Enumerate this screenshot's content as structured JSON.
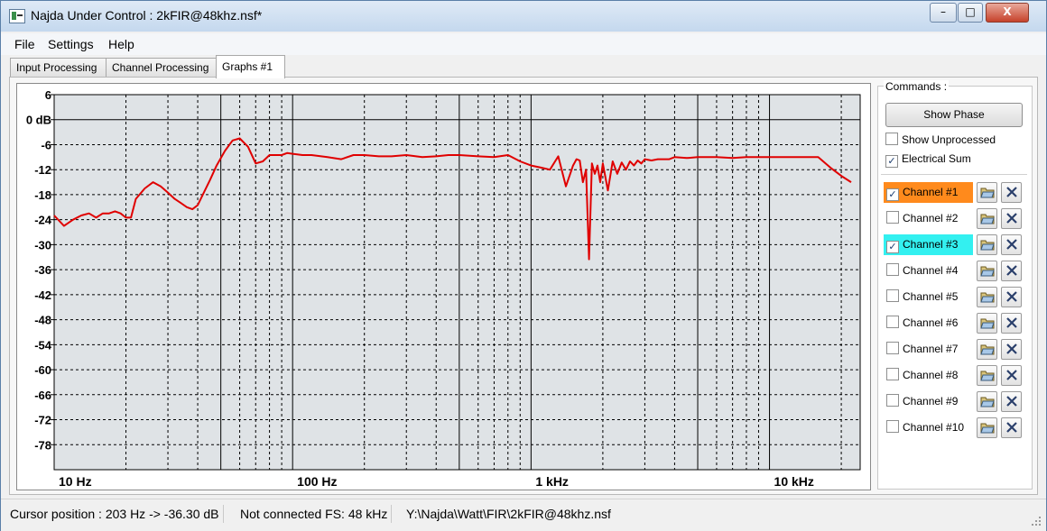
{
  "window": {
    "title": "Najda Under Control : 2kFIR@48khz.nsf*",
    "controls": [
      "–",
      "□",
      "X"
    ]
  },
  "menu": [
    {
      "label": "File"
    },
    {
      "label": "Settings"
    },
    {
      "label": "Help"
    }
  ],
  "tabs": [
    {
      "label": "Input Processing"
    },
    {
      "label": "Channel Processing"
    },
    {
      "label": "Graphs #1",
      "active": true
    }
  ],
  "graph": {
    "y_labels": [
      "6",
      "0 dB",
      "-6",
      "-12",
      "-18",
      "-24",
      "-30",
      "-36",
      "-42",
      "-48",
      "-54",
      "-60",
      "-66",
      "-72",
      "-78"
    ],
    "x_labels": [
      "10 Hz",
      "100 Hz",
      "1 kHz",
      "10 kHz"
    ],
    "curve_color": "#e00000",
    "background": "#dfe3e6"
  },
  "chart_data": {
    "type": "line",
    "x_scale": "log",
    "xlim": [
      10,
      24000
    ],
    "ylim": [
      -84,
      6
    ],
    "y_ticks": [
      6,
      0,
      -6,
      -12,
      -18,
      -24,
      -30,
      -36,
      -42,
      -48,
      -54,
      -60,
      -66,
      -72,
      -78
    ],
    "x_ticks": [
      10,
      100,
      1000,
      10000
    ],
    "series": [
      {
        "color": "#e00000",
        "x": [
          10,
          11,
          12,
          13,
          14,
          15,
          16,
          17,
          18,
          19,
          20,
          21,
          22,
          24,
          26,
          28,
          30,
          32,
          34,
          36,
          38,
          40,
          42,
          45,
          48,
          52,
          56,
          60,
          65,
          70,
          75,
          80,
          85,
          90,
          95,
          100,
          110,
          120,
          140,
          160,
          180,
          200,
          230,
          260,
          300,
          350,
          400,
          450,
          500,
          600,
          700,
          800,
          900,
          1000,
          1100,
          1200,
          1300,
          1400,
          1500,
          1550,
          1600,
          1650,
          1700,
          1750,
          1800,
          1850,
          1900,
          1950,
          2000,
          2100,
          2200,
          2300,
          2400,
          2500,
          2600,
          2700,
          2800,
          2900,
          3000,
          3200,
          3400,
          3600,
          3800,
          4000,
          4500,
          5000,
          6000,
          7000,
          8000,
          9000,
          10000,
          12000,
          14000,
          16000,
          18000,
          20000,
          22000
        ],
        "y": [
          -23,
          -25.5,
          -24,
          -23,
          -22.5,
          -23.5,
          -22.5,
          -22.5,
          -22,
          -22.5,
          -23.5,
          -23.5,
          -19,
          -16.5,
          -15,
          -16,
          -17.5,
          -19,
          -20,
          -21,
          -21.5,
          -20.5,
          -18,
          -14.5,
          -11,
          -7.5,
          -5,
          -4.5,
          -6.5,
          -10.5,
          -10,
          -8.5,
          -8.5,
          -8.5,
          -8,
          -8.2,
          -8.5,
          -8.5,
          -9,
          -9.5,
          -8.5,
          -8.5,
          -8.8,
          -8.8,
          -8.5,
          -9,
          -8.8,
          -8.5,
          -8.5,
          -8.8,
          -9,
          -8.5,
          -10,
          -11,
          -11.5,
          -12,
          -8.8,
          -16,
          -11,
          -9.5,
          -9.8,
          -15,
          -12,
          -33.5,
          -10.5,
          -13,
          -11,
          -15,
          -10.5,
          -17,
          -10,
          -13,
          -10.3,
          -12,
          -10,
          -11,
          -9.8,
          -10.5,
          -9.5,
          -9.8,
          -9.5,
          -9.5,
          -9.5,
          -9,
          -9.2,
          -9,
          -9,
          -9.2,
          -9,
          -9,
          -9,
          -9,
          -9,
          -9,
          -11.5,
          -13.5,
          -15
        ]
      }
    ]
  },
  "commands": {
    "label": "Commands :",
    "show_phase": "Show Phase",
    "show_unprocessed": {
      "label": "Show Unprocessed",
      "checked": false
    },
    "electrical_sum": {
      "label": "Electrical Sum",
      "checked": true
    }
  },
  "channels": [
    {
      "label": "Channel #1",
      "checked": true,
      "color": "#ff8a1c"
    },
    {
      "label": "Channel #2",
      "checked": false,
      "color": ""
    },
    {
      "label": "Channel #3",
      "checked": true,
      "color": "#33f0f0"
    },
    {
      "label": "Channel #4",
      "checked": false,
      "color": ""
    },
    {
      "label": "Channel #5",
      "checked": false,
      "color": ""
    },
    {
      "label": "Channel #6",
      "checked": false,
      "color": ""
    },
    {
      "label": "Channel #7",
      "checked": false,
      "color": ""
    },
    {
      "label": "Channel #8",
      "checked": false,
      "color": ""
    },
    {
      "label": "Channel #9",
      "checked": false,
      "color": ""
    },
    {
      "label": "Channel #10",
      "checked": false,
      "color": ""
    }
  ],
  "status": {
    "cursor": "Cursor position : 203 Hz -> -36.30 dB",
    "connection": "Not connected FS: 48 kHz",
    "file": "Y:\\Najda\\Watt\\FIR\\2kFIR@48khz.nsf"
  }
}
